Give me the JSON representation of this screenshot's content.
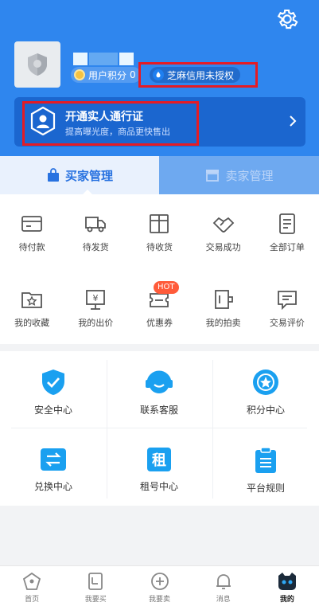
{
  "header": {
    "points_label": "用户积分",
    "points_value": "0",
    "zhima_label": "芝麻信用未授权"
  },
  "verify_banner": {
    "title": "开通实人通行证",
    "subtitle": "提高曝光度，商品更快售出"
  },
  "tabs": [
    {
      "label": "买家管理",
      "active": true
    },
    {
      "label": "卖家管理",
      "active": false
    }
  ],
  "orders": [
    {
      "label": "待付款",
      "icon": "wallet-icon"
    },
    {
      "label": "待发货",
      "icon": "truck-icon"
    },
    {
      "label": "待收货",
      "icon": "box-icon"
    },
    {
      "label": "交易成功",
      "icon": "handshake-icon"
    },
    {
      "label": "全部订单",
      "icon": "list-icon"
    }
  ],
  "tools": [
    {
      "label": "我的收藏",
      "icon": "star-folder-icon"
    },
    {
      "label": "我的出价",
      "icon": "price-tag-icon"
    },
    {
      "label": "优惠券",
      "icon": "coupon-icon",
      "badge": "HOT"
    },
    {
      "label": "我的拍卖",
      "icon": "auction-icon"
    },
    {
      "label": "交易评价",
      "icon": "review-icon"
    }
  ],
  "services": [
    {
      "label": "安全中心",
      "icon": "shield-check-icon"
    },
    {
      "label": "联系客服",
      "icon": "headset-icon"
    },
    {
      "label": "积分中心",
      "icon": "points-star-icon"
    },
    {
      "label": "兑换中心",
      "icon": "exchange-icon"
    },
    {
      "label": "租号中心",
      "icon": "rent-icon",
      "icon_text": "租"
    },
    {
      "label": "平台规则",
      "icon": "rules-icon"
    }
  ],
  "bottom_nav": [
    {
      "label": "首页",
      "icon": "home-icon"
    },
    {
      "label": "我要买",
      "icon": "buy-icon"
    },
    {
      "label": "我要卖",
      "icon": "sell-icon"
    },
    {
      "label": "消息",
      "icon": "bell-icon"
    },
    {
      "label": "我的",
      "icon": "cat-profile-icon",
      "active": true
    }
  ],
  "colors": {
    "brand_blue": "#2f86ee",
    "banner_blue": "#1b66cf",
    "highlight_red": "#e51b24",
    "hot_badge": "#ff5b3a",
    "service_blue": "#1aa0f0"
  }
}
